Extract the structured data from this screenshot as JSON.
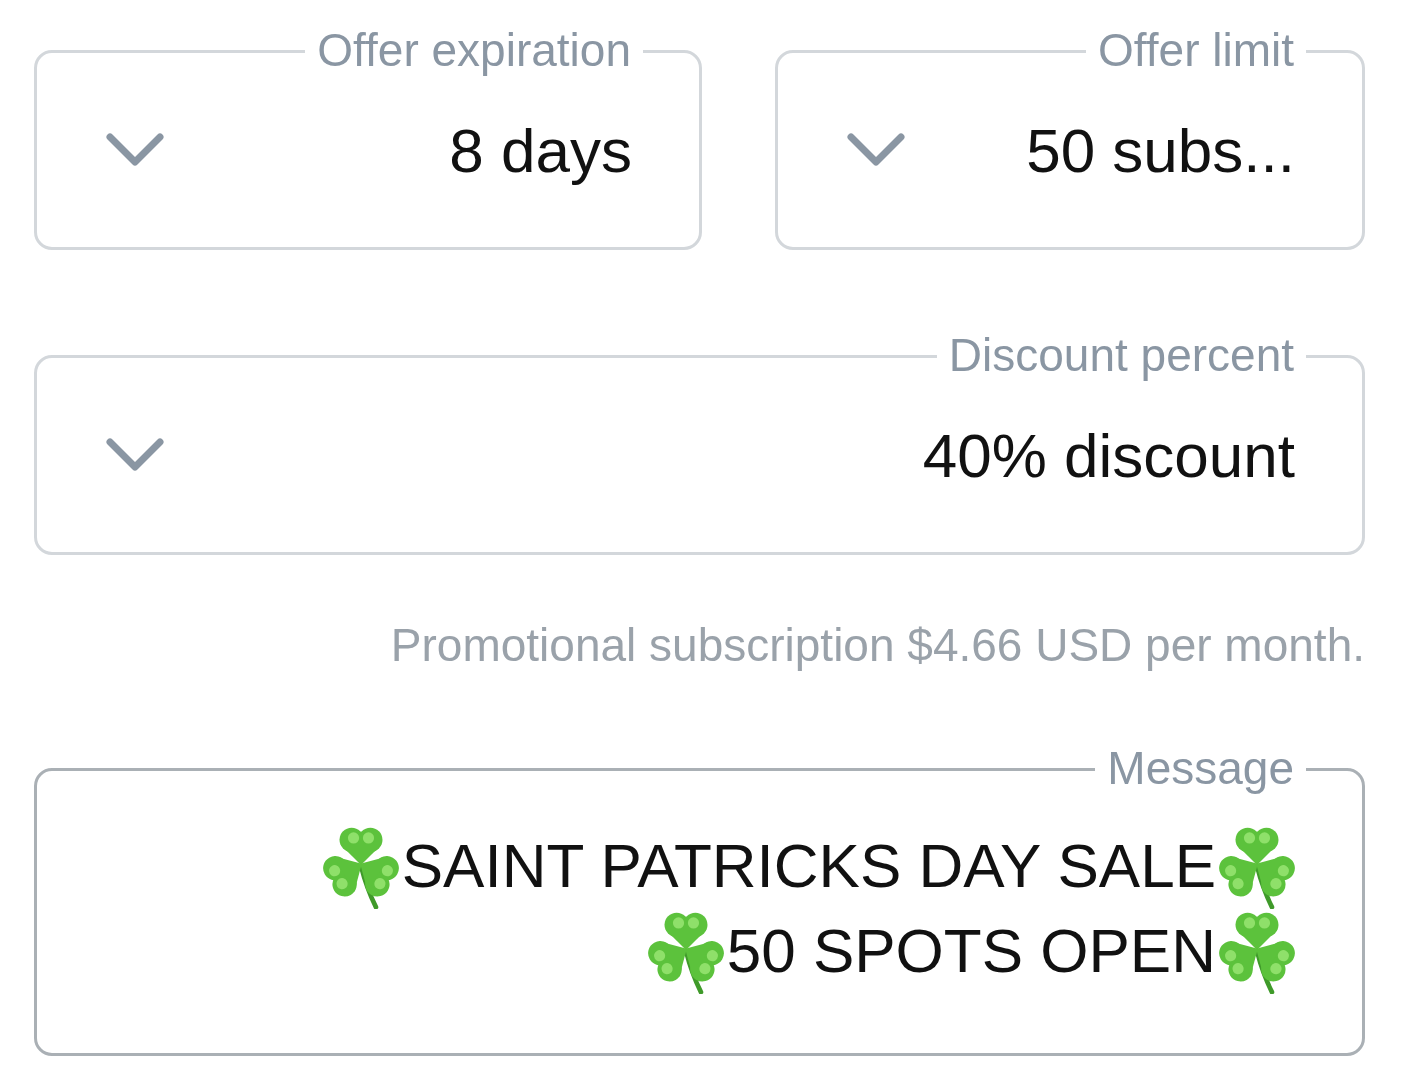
{
  "selects": [
    {
      "label": "Offer expiration",
      "value": "8 days"
    },
    {
      "label": "Offer limit",
      "value": "50 subs..."
    }
  ],
  "discount_select": {
    "label": "Discount percent",
    "value": "40% discount"
  },
  "helper_text": "Promotional subscription $4.66 USD per month.",
  "message": {
    "label": "Message",
    "lines": [
      {
        "segments": [
          {
            "kind": "emoji"
          },
          {
            "kind": "text",
            "text": "SAINT PATRICKS DAY SALE"
          },
          {
            "kind": "emoji"
          }
        ]
      },
      {
        "segments": [
          {
            "kind": "emoji"
          },
          {
            "kind": "text",
            "text": "50 SPOTS OPEN"
          },
          {
            "kind": "emoji"
          }
        ]
      }
    ]
  }
}
